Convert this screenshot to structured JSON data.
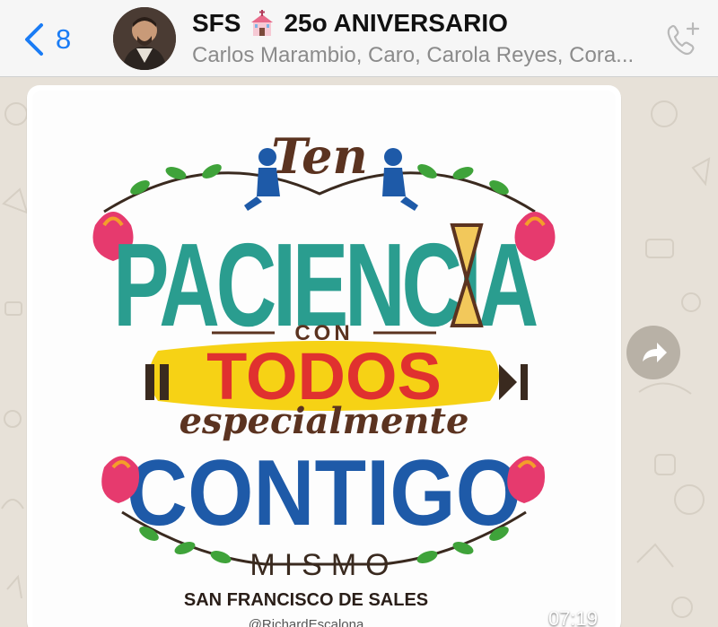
{
  "header": {
    "back_count": "8",
    "title": "SFS",
    "title_suffix": "25o ANIVERSARIO",
    "subtitle": "Carlos Marambio, Caro, Carola Reyes, Cora..."
  },
  "message": {
    "image": {
      "line_ten": "Ten",
      "line_paciencia": "PACIENCIA",
      "line_con": "CON",
      "line_todos": "TODOS",
      "line_especialmente": "especialmente",
      "line_contigo": "CONTIGO",
      "line_mismo": "MISMO",
      "line_author": "SAN FRANCISCO DE SALES",
      "line_credit": "@RichardEscalona"
    },
    "time": "07:19"
  },
  "colors": {
    "accent": "#1a7cf5",
    "teal": "#2a9d8f",
    "red": "#e0312f",
    "yellow": "#f6d215",
    "blue": "#1e5aa8",
    "brown": "#5b3320"
  },
  "icons": {
    "back": "chevron-left-icon",
    "call": "add-call-icon",
    "forward": "forward-arrow-icon",
    "title_emoji": "church-icon"
  }
}
